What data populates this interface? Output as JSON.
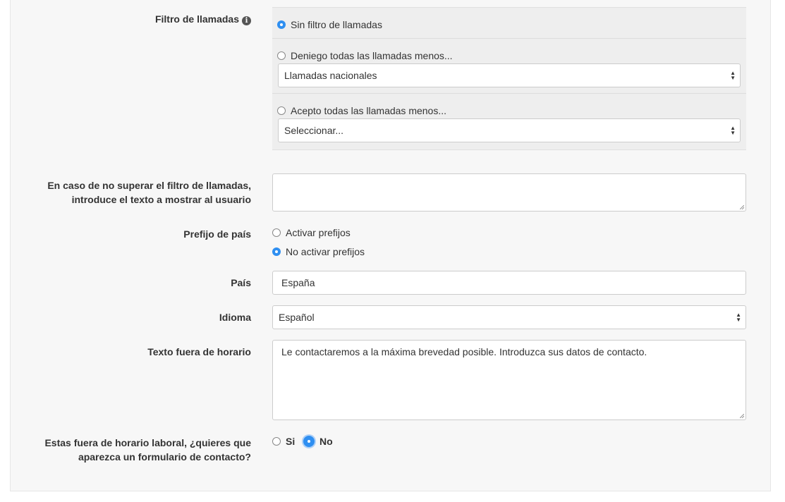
{
  "call_filter": {
    "label": "Filtro de llamadas",
    "info_icon": "info-circle-icon",
    "options": [
      {
        "label": "Sin filtro de llamadas",
        "checked": true
      },
      {
        "label": "Deniego todas las llamadas menos...",
        "checked": false,
        "select_value": "Llamadas nacionales"
      },
      {
        "label": "Acepto todas las llamadas menos...",
        "checked": false,
        "select_value": "Seleccionar..."
      }
    ]
  },
  "filter_fail_text": {
    "label_line1": "En caso de no superar el filtro de llamadas,",
    "label_line2": "introduce el texto a mostrar al usuario",
    "value": ""
  },
  "country_prefix": {
    "label": "Prefijo de país",
    "options": [
      {
        "label": "Activar prefijos",
        "checked": false
      },
      {
        "label": "No activar prefijos",
        "checked": true
      }
    ]
  },
  "country": {
    "label": "País",
    "value": "España"
  },
  "language": {
    "label": "Idioma",
    "value": "Español"
  },
  "out_of_hours_text": {
    "label": "Texto fuera de horario",
    "value": "Le contactaremos a la máxima brevedad posible. Introduzca sus datos de contacto."
  },
  "contact_form": {
    "label_line1": "Estas fuera de horario laboral, ¿quieres que",
    "label_line2": "aparezca un formulario de contacto?",
    "options": [
      {
        "label": "Si",
        "checked": false
      },
      {
        "label": "No",
        "checked": true
      }
    ]
  },
  "colors": {
    "accent": "#2f8ff1",
    "panel_bg": "#f7f7f7"
  }
}
